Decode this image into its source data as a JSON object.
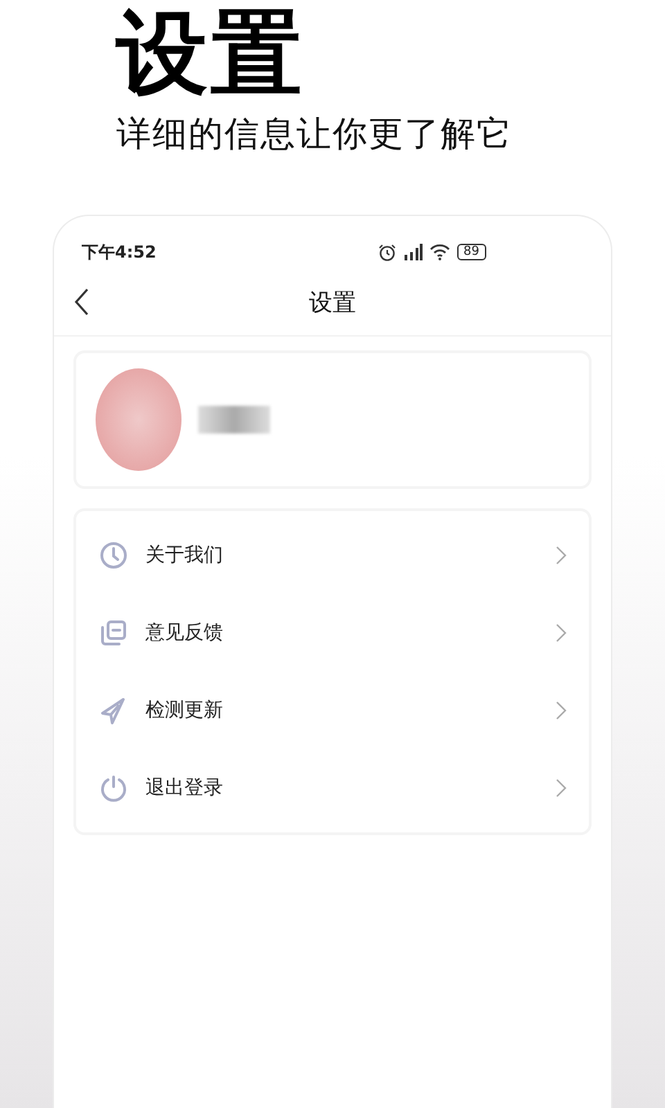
{
  "headline": {
    "title": "设置",
    "subtitle": "详细的信息让你更了解它"
  },
  "status_bar": {
    "time": "下午4:52",
    "battery": "89"
  },
  "nav": {
    "title": "设置"
  },
  "menu": [
    {
      "kind": "clock",
      "label": "关于我们"
    },
    {
      "kind": "feedback",
      "label": "意见反馈"
    },
    {
      "kind": "send",
      "label": "检测更新"
    },
    {
      "kind": "power",
      "label": "退出登录"
    }
  ]
}
